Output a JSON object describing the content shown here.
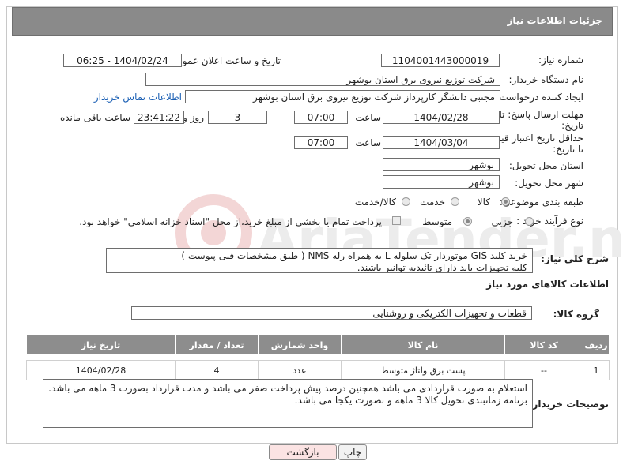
{
  "header": {
    "title": "جزئیات اطلاعات نیاز"
  },
  "need_number": {
    "label": "شماره نیاز:",
    "value": "1104001443000019"
  },
  "announce": {
    "label": "تاریخ و ساعت اعلان عمومی:",
    "value": "1404/02/24 - 06:25"
  },
  "buyer_org": {
    "label": "نام دستگاه خریدار:",
    "value": "شرکت توزیع نیروی برق استان بوشهر"
  },
  "requester": {
    "label": "ایجاد کننده درخواست:",
    "value": "مجتبی دانشگر کارپرداز شرکت توزیع نیروی برق استان بوشهر",
    "contact_link": "اطلاعات تماس خریدار"
  },
  "deadline": {
    "label_line1": "مهلت ارسال پاسخ: تا",
    "label_line2": "تاریخ:",
    "date": "1404/02/28",
    "time_label": "ساعت",
    "time": "07:00",
    "days": "3",
    "days_label": "روز و",
    "remaining": "23:41:22",
    "remaining_label": "ساعت باقی مانده"
  },
  "price_validity": {
    "label_line1": "حداقل تاریخ اعتبار قیمت:",
    "label_line2": "تا تاریخ:",
    "date": "1404/03/04",
    "time_label": "ساعت",
    "time": "07:00"
  },
  "province": {
    "label": "استان محل تحویل:",
    "value": "بوشهر"
  },
  "city": {
    "label": "شهر محل تحویل:",
    "value": "بوشهر"
  },
  "category": {
    "label": "طبقه بندی موضوعی:",
    "options": [
      "کالا",
      "خدمت",
      "کالا/خدمت"
    ],
    "selected": 0
  },
  "purchase_type": {
    "label": "نوع فرآیند خرید :",
    "options": [
      "جزیی",
      "متوسط"
    ],
    "selected": 1,
    "payment_note": "پرداخت تمام یا بخشی از مبلغ خرید،از محل \"اسناد خزانه اسلامی\" خواهد بود."
  },
  "description": {
    "label": "شرح کلی نیاز:",
    "line1": "خرید کلید GIS موتوردار تک سلوله L به همراه رله NMS ( طبق مشخصات فنی پیوست )",
    "line2": "کلیه تجهیزات باید دارای تائیدیه توانیر باشند."
  },
  "goods_info": {
    "title": "اطلاعات کالاهای مورد نیاز"
  },
  "goods_group": {
    "label": "گروه کالا:",
    "value": "قطعات و تجهیزات الکتریکی و روشنایی"
  },
  "table": {
    "headers": [
      "ردیف",
      "کد کالا",
      "نام کالا",
      "واحد شمارش",
      "تعداد / مقدار",
      "تاریخ نیاز"
    ],
    "rows": [
      [
        "1",
        "--",
        "پست برق ولتاژ متوسط",
        "عدد",
        "4",
        "1404/02/28"
      ]
    ]
  },
  "buyer_notes": {
    "label": "توضیحات خریدار:",
    "line1": "استعلام به صورت قراردادی می باشد همچنین درصد پیش پرداخت صفر می باشد و مدت قرارداد بصورت 3 ماهه می باشد.",
    "line2": "برنامه زمانبندی تحویل کالا 3 ماهه و  بصورت یکجا می باشد."
  },
  "buttons": {
    "print": "چاپ",
    "back": "بازگشت"
  },
  "colors": {
    "header_bg": "#8a8a8a",
    "back_button_bg": "#fbe3e3",
    "link": "#1a5fb4"
  },
  "watermark": {
    "text": "AriaTender.neT"
  }
}
